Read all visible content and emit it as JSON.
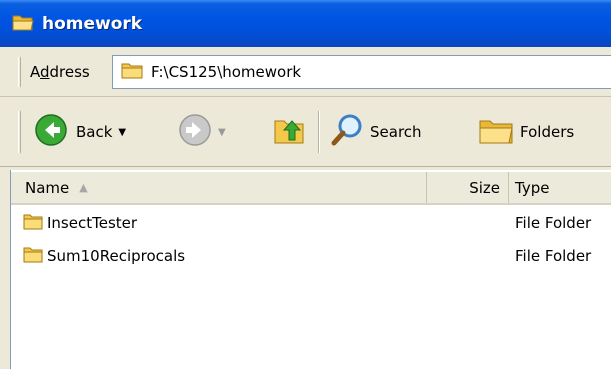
{
  "window": {
    "title": "homework",
    "icon": "folder-open-icon"
  },
  "address": {
    "label_prefix": "A",
    "label_underlined": "d",
    "label_suffix": "dress",
    "path": "F:\\CS125\\homework",
    "icon": "folder-icon"
  },
  "toolbar": {
    "back_label": "Back",
    "search_label": "Search",
    "folders_label": "Folders"
  },
  "list": {
    "columns": {
      "name": "Name",
      "size": "Size",
      "type": "Type"
    },
    "rows": [
      {
        "name": "InsectTester",
        "size": "",
        "type": "File Folder"
      },
      {
        "name": "Sum10Reciprocals",
        "size": "",
        "type": "File Folder"
      }
    ]
  },
  "colors": {
    "titlebar": "#0054e3",
    "folder": "#f4c84a"
  }
}
